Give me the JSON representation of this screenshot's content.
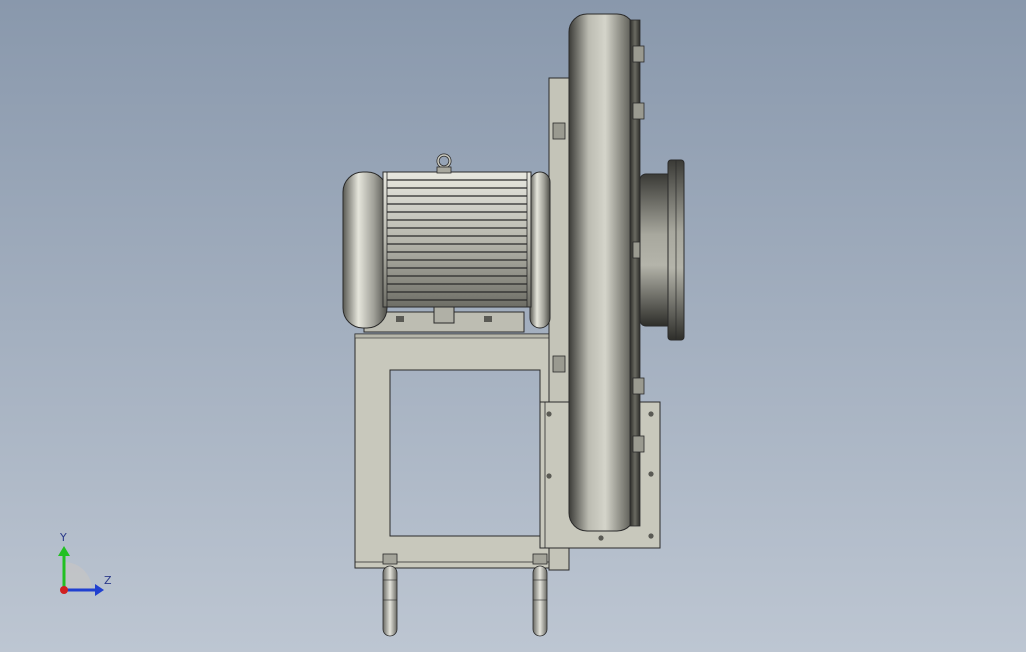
{
  "viewport": {
    "background_top": "#8998ac",
    "background_bottom": "#bdc6d2"
  },
  "model": {
    "components": [
      "motor",
      "lifting-eye",
      "motor-base",
      "support-frame",
      "mounting-plate",
      "fan-housing",
      "outlet-flange",
      "corner-bracket",
      "leveling-feet"
    ],
    "colors": {
      "metal_light": "#cfcfc4",
      "metal_dark": "#3a3a38",
      "frame": "#c8c8bc",
      "outline": "#2a2a2a"
    }
  },
  "triad": {
    "y_label": "Y",
    "z_label": "Z",
    "y_color": "#22c022",
    "z_color": "#2040d0",
    "x_color": "#d02020"
  }
}
